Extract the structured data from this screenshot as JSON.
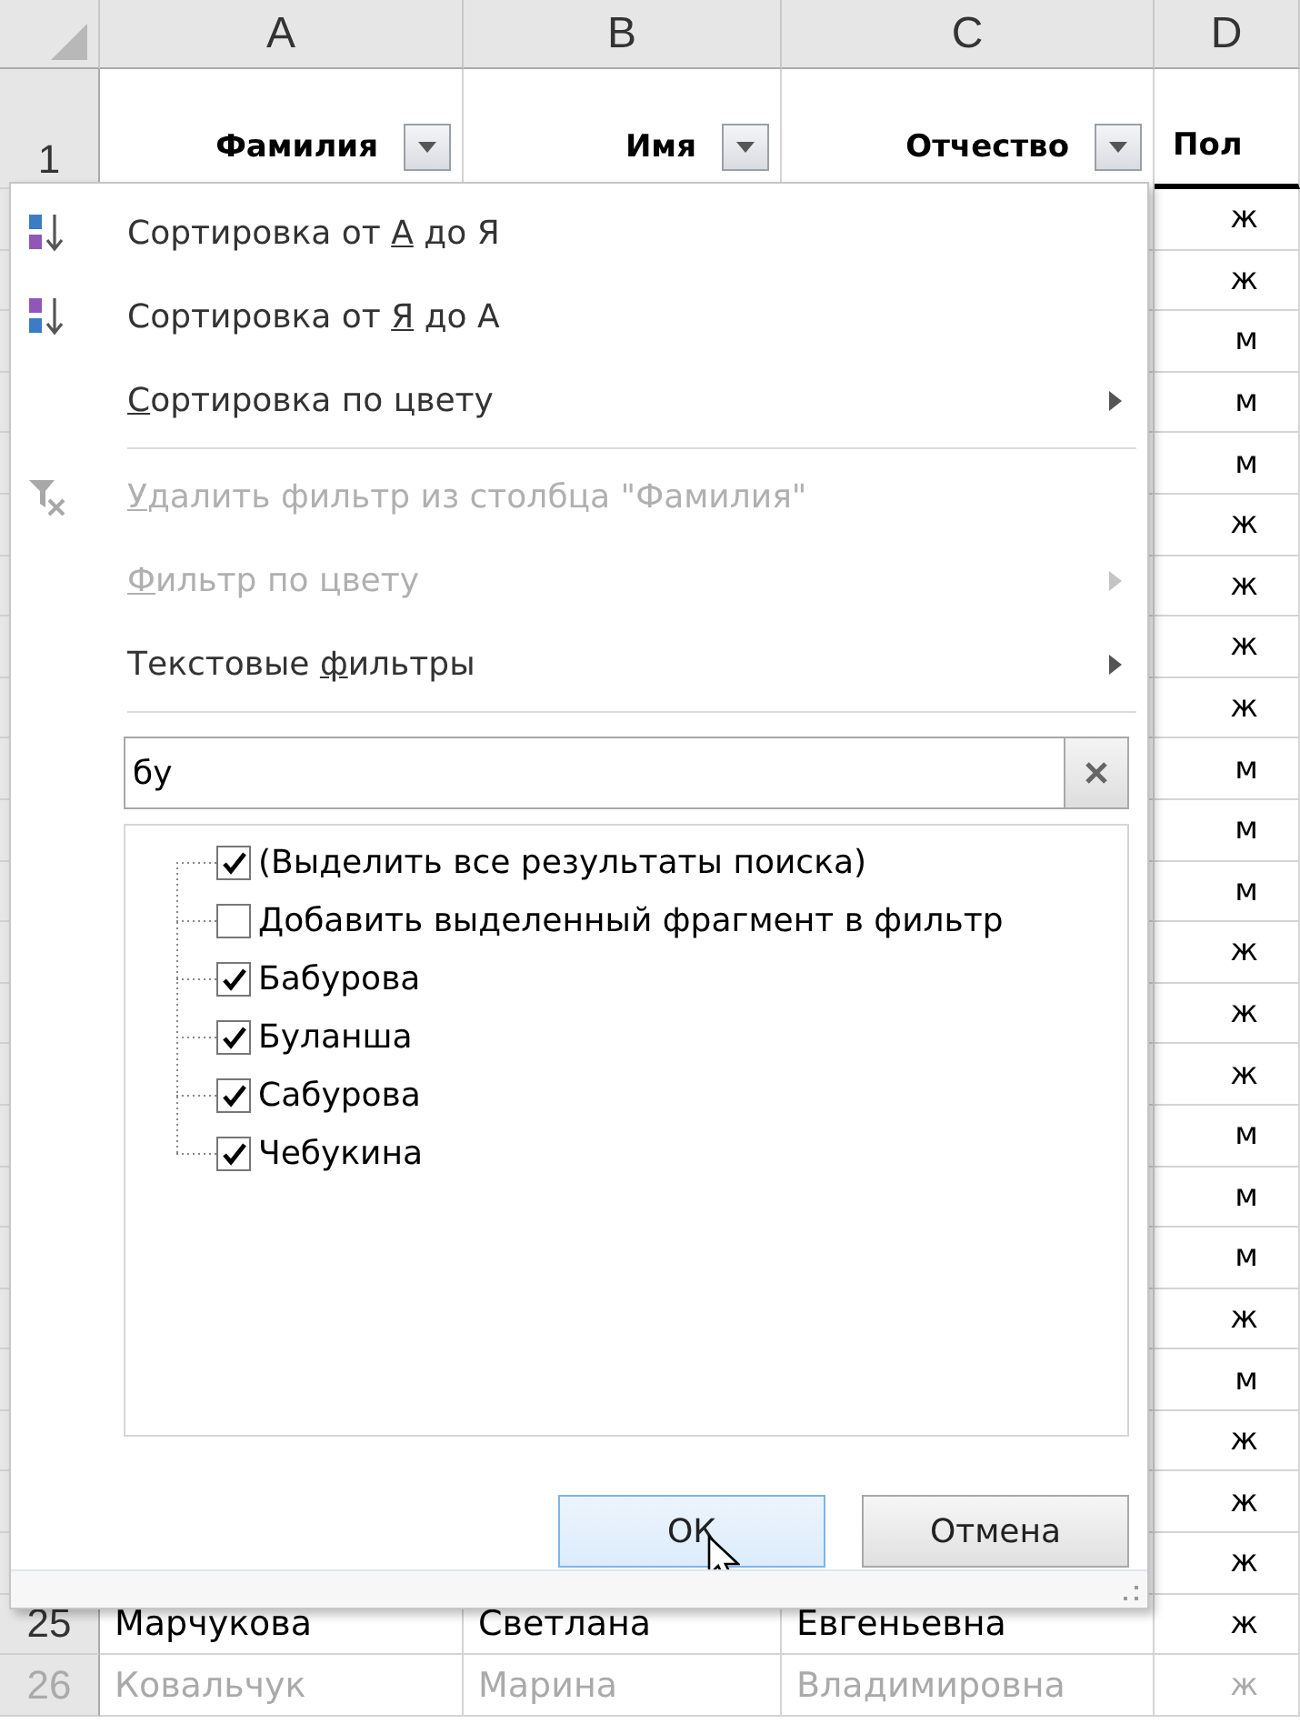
{
  "columns": [
    {
      "letter": "A"
    },
    {
      "letter": "B"
    },
    {
      "letter": "C"
    },
    {
      "letter": "D"
    }
  ],
  "header_row": {
    "number": "1",
    "cells": [
      {
        "text": "Фамилия",
        "filter": true
      },
      {
        "text": "Имя",
        "filter": true
      },
      {
        "text": "Отчество",
        "filter": true
      },
      {
        "text": "Пол",
        "filter": false
      }
    ]
  },
  "rows": [
    {
      "pol": "ж"
    },
    {
      "pol": "ж"
    },
    {
      "pol": "м"
    },
    {
      "pol": "м"
    },
    {
      "pol": "м"
    },
    {
      "pol": "ж"
    },
    {
      "pol": "ж"
    },
    {
      "pol": "ж"
    },
    {
      "pol": "ж"
    },
    {
      "pol": "м"
    },
    {
      "pol": "м"
    },
    {
      "pol": "м"
    },
    {
      "pol": "ж"
    },
    {
      "pol": "ж"
    },
    {
      "pol": "ж"
    },
    {
      "pol": "м"
    },
    {
      "pol": "м"
    },
    {
      "pol": "м"
    },
    {
      "pol": "ж"
    },
    {
      "pol": "м"
    },
    {
      "pol": "ж"
    },
    {
      "pol": "ж"
    },
    {
      "pol": "ж"
    },
    {
      "number": "25",
      "cells": [
        "Марчукова",
        "Светлана",
        "Евгеньевна"
      ],
      "pol": "ж",
      "dimmed": false
    },
    {
      "number": "26",
      "cells": [
        "Ковальчук",
        "Марина",
        "Владимировна"
      ],
      "pol": "ж",
      "dimmed": true
    }
  ],
  "filter_menu": {
    "items": [
      {
        "kind": "item",
        "before": "Сортировка от ",
        "key": "А",
        "after": " до Я",
        "disabled": false,
        "submenu": false
      },
      {
        "kind": "item",
        "before": "Сортировка от ",
        "key": "Я",
        "after": " до А",
        "disabled": false,
        "submenu": false
      },
      {
        "kind": "item",
        "key": "С",
        "after": "ортировка по цвету",
        "disabled": false,
        "submenu": true
      },
      {
        "kind": "separator"
      },
      {
        "kind": "item",
        "key": "У",
        "after": "далить фильтр из столбца \"Фамилия\"",
        "disabled": true,
        "submenu": false
      },
      {
        "kind": "item",
        "key": "Ф",
        "after": "ильтр по цвету",
        "disabled": true,
        "submenu": true
      },
      {
        "kind": "item",
        "before": "Текстовые ",
        "key": "ф",
        "after": "ильтры",
        "disabled": false,
        "submenu": true
      },
      {
        "kind": "separator"
      }
    ],
    "search": {
      "value": "бу"
    },
    "list": [
      {
        "label": "(Выделить все результаты поиска)",
        "checked": true
      },
      {
        "label": "Добавить выделенный фрагмент в фильтр",
        "checked": false
      },
      {
        "label": "Бабурова",
        "checked": true
      },
      {
        "label": "Буланша",
        "checked": true
      },
      {
        "label": "Сабурова",
        "checked": true
      },
      {
        "label": "Чебукина",
        "checked": true
      }
    ],
    "buttons": [
      {
        "label": "ОК",
        "hovered": true
      },
      {
        "label": "Отмена",
        "hovered": false
      }
    ]
  }
}
